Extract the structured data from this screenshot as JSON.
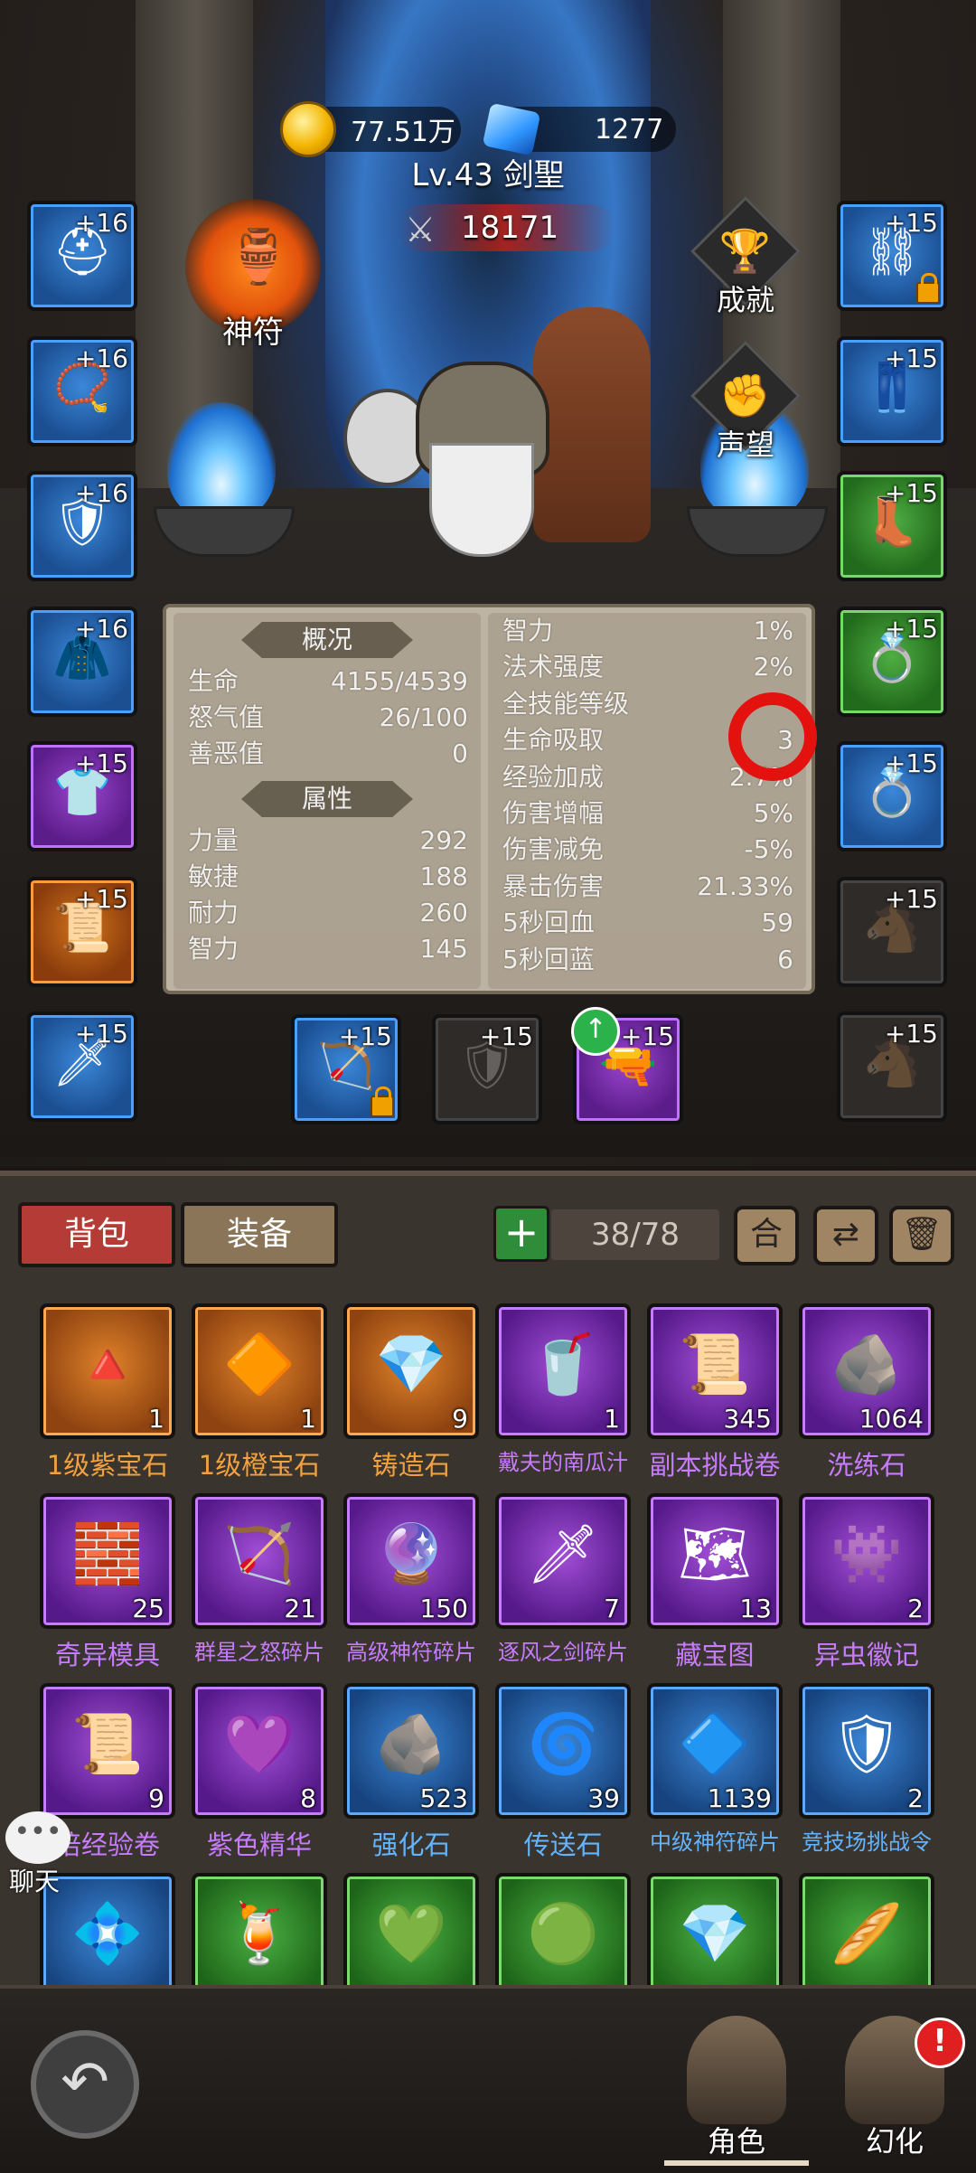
{
  "currency": {
    "gold": "77.51万",
    "diamond": "1277"
  },
  "hero": {
    "title": "Lv.43 剑聖",
    "power": "18171"
  },
  "buttons": {
    "rune": "神符",
    "achievement": "成就",
    "reputation": "声望",
    "chat": "聊天"
  },
  "equip_left": [
    {
      "level": "+16",
      "rarity": "blue",
      "icon": "helmet-icon"
    },
    {
      "level": "+16",
      "rarity": "blue",
      "icon": "necklace-icon"
    },
    {
      "level": "+16",
      "rarity": "blue",
      "icon": "bracer-icon"
    },
    {
      "level": "+16",
      "rarity": "blue",
      "icon": "cloak-icon"
    },
    {
      "level": "+15",
      "rarity": "purple",
      "icon": "shirt-icon"
    },
    {
      "level": "+15",
      "rarity": "orange",
      "icon": "scroll-icon"
    },
    {
      "level": "+15",
      "rarity": "blue",
      "icon": "sword-icon"
    }
  ],
  "equip_right": [
    {
      "level": "+15",
      "rarity": "blue",
      "icon": "chain-icon",
      "locked": true
    },
    {
      "level": "+15",
      "rarity": "blue",
      "icon": "leg-armor-icon"
    },
    {
      "level": "+15",
      "rarity": "green",
      "icon": "boots-icon"
    },
    {
      "level": "+15",
      "rarity": "green",
      "icon": "ring-icon"
    },
    {
      "level": "+15",
      "rarity": "blue",
      "icon": "ring-icon"
    },
    {
      "level": "+15",
      "rarity": "empty",
      "icon": "mount-placeholder-icon"
    },
    {
      "level": "+15",
      "rarity": "empty",
      "icon": "mount-placeholder-icon"
    }
  ],
  "equip_bottom": [
    {
      "level": "+15",
      "rarity": "blue",
      "icon": "crossbow-icon",
      "locked": true
    },
    {
      "level": "+15",
      "rarity": "empty",
      "icon": "shield-icon"
    },
    {
      "level": "+15",
      "rarity": "purple",
      "icon": "gun-icon",
      "upgrade": true
    }
  ],
  "stats": {
    "overview_header": "概况",
    "overview": [
      {
        "label": "生命",
        "value": "4155/4539"
      },
      {
        "label": "怒气值",
        "value": "26/100"
      },
      {
        "label": "善恶值",
        "value": "0"
      }
    ],
    "attr_header": "属性",
    "attributes": [
      {
        "label": "力量",
        "value": "292"
      },
      {
        "label": "敏捷",
        "value": "188"
      },
      {
        "label": "耐力",
        "value": "260"
      },
      {
        "label": "智力",
        "value": "145"
      }
    ],
    "right": [
      {
        "label": "智力",
        "value": "1%"
      },
      {
        "label": "法术强度",
        "value": "2%"
      },
      {
        "label": "全技能等级",
        "value": ""
      },
      {
        "label": "生命吸取",
        "value": "3"
      },
      {
        "label": "经验加成",
        "value": "2.7%"
      },
      {
        "label": "伤害增幅",
        "value": "5%"
      },
      {
        "label": "伤害减免",
        "value": "-5%"
      },
      {
        "label": "暴击伤害",
        "value": "21.33%"
      },
      {
        "label": "5秒回血",
        "value": "59"
      },
      {
        "label": "5秒回蓝",
        "value": "6"
      }
    ]
  },
  "inventory": {
    "tabs": {
      "bag": "背包",
      "equip": "装备"
    },
    "capacity": "38/78",
    "tools": {
      "merge": "合"
    },
    "items": [
      {
        "name": "1级紫宝石",
        "count": "1",
        "rarity": "orange",
        "icon": "purple-gem-icon"
      },
      {
        "name": "1级橙宝石",
        "count": "1",
        "rarity": "orange",
        "icon": "orange-gem-icon"
      },
      {
        "name": "铸造石",
        "count": "9",
        "rarity": "orange",
        "icon": "forge-stone-icon"
      },
      {
        "name": "戴夫的南瓜汁",
        "count": "1",
        "rarity": "purple",
        "icon": "juice-icon"
      },
      {
        "name": "副本挑战卷",
        "count": "345",
        "rarity": "purple",
        "icon": "challenge-scroll-icon"
      },
      {
        "name": "洗练石",
        "count": "1064",
        "rarity": "purple",
        "icon": "refine-stone-icon"
      },
      {
        "name": "奇异模具",
        "count": "25",
        "rarity": "purple",
        "icon": "mold-icon"
      },
      {
        "name": "群星之怒碎片",
        "count": "21",
        "rarity": "purple",
        "icon": "bow-shard-icon"
      },
      {
        "name": "高级神符碎片",
        "count": "150",
        "rarity": "purple",
        "icon": "rune-shard-icon"
      },
      {
        "name": "逐风之剑碎片",
        "count": "7",
        "rarity": "purple",
        "icon": "sword-shard-icon"
      },
      {
        "name": "藏宝图",
        "count": "13",
        "rarity": "purple",
        "icon": "treasure-map-icon"
      },
      {
        "name": "异虫徽记",
        "count": "2",
        "rarity": "purple",
        "icon": "insect-emblem-icon"
      },
      {
        "name": "倍经验卷",
        "count": "9",
        "rarity": "purple",
        "icon": "exp-scroll-icon"
      },
      {
        "name": "紫色精华",
        "count": "8",
        "rarity": "purple",
        "icon": "purple-essence-icon"
      },
      {
        "name": "强化石",
        "count": "523",
        "rarity": "blue",
        "icon": "enhance-stone-icon"
      },
      {
        "name": "传送石",
        "count": "39",
        "rarity": "blue",
        "icon": "teleport-stone-icon"
      },
      {
        "name": "中级神符碎片",
        "count": "1139",
        "rarity": "blue",
        "icon": "mid-rune-shard-icon"
      },
      {
        "name": "竞技场挑战令",
        "count": "2",
        "rarity": "blue",
        "icon": "arena-token-icon"
      },
      {
        "name": "",
        "count": "",
        "rarity": "blue",
        "icon": "blue-crystal-icon"
      },
      {
        "name": "",
        "count": "",
        "rarity": "green",
        "icon": "cocktail-icon"
      },
      {
        "name": "",
        "count": "",
        "rarity": "green",
        "icon": "green-gem-icon"
      },
      {
        "name": "",
        "count": "",
        "rarity": "green",
        "icon": "green-orb-icon"
      },
      {
        "name": "",
        "count": "",
        "rarity": "green",
        "icon": "green-crystal-icon"
      },
      {
        "name": "",
        "count": "",
        "rarity": "green",
        "icon": "baguette-icon"
      }
    ]
  },
  "nav": {
    "character": "角色",
    "transform": "幻化",
    "alert": "!"
  }
}
